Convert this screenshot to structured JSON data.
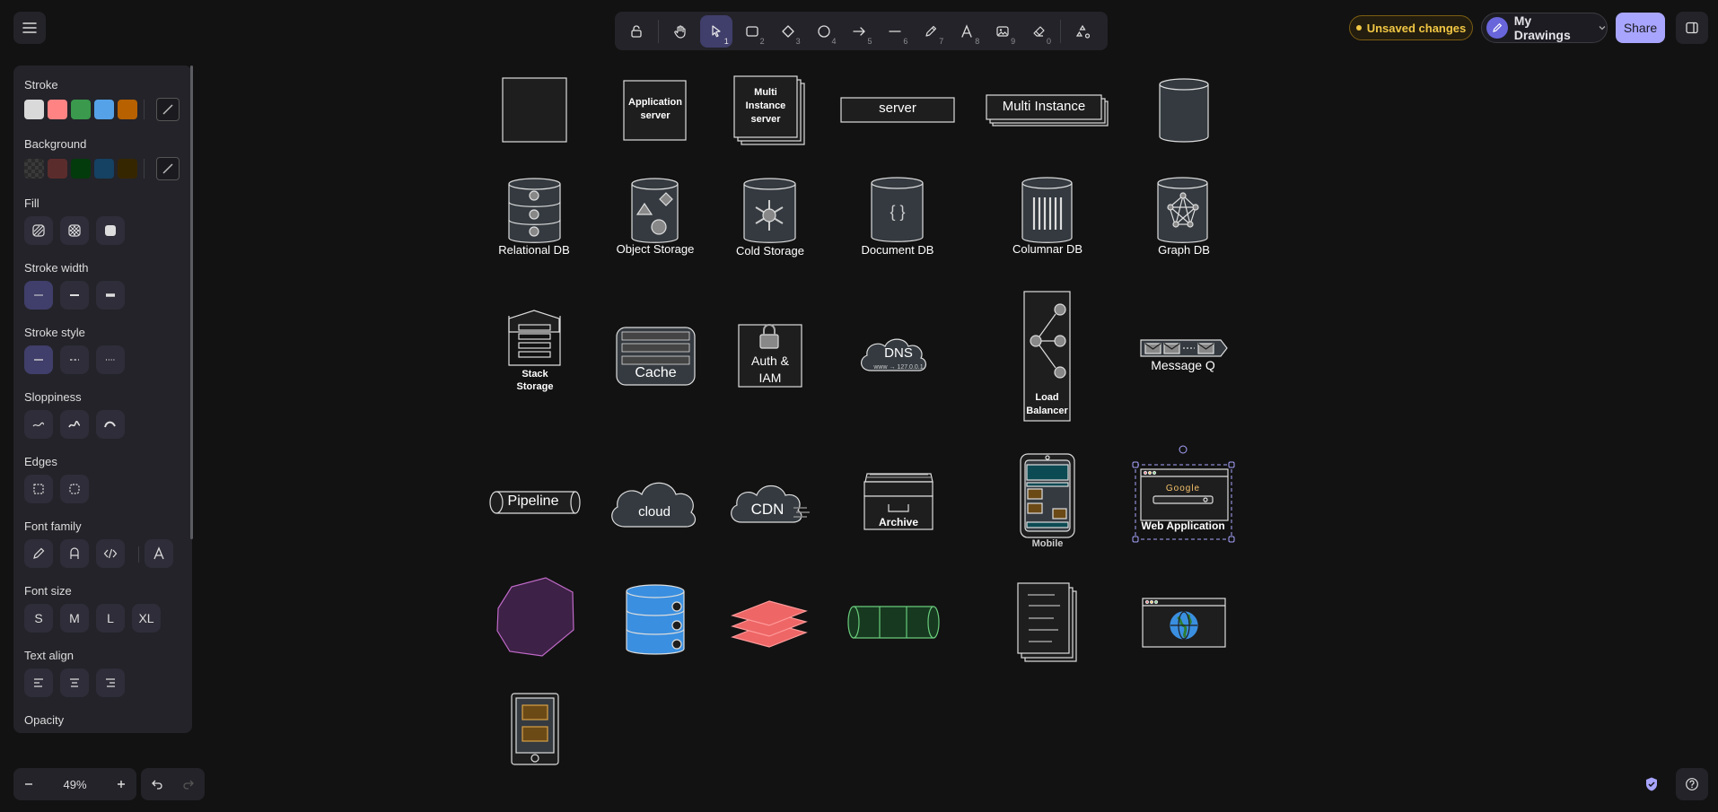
{
  "toolbar": {
    "tools": [
      {
        "name": "lock",
        "key": ""
      },
      {
        "name": "hand",
        "key": ""
      },
      {
        "name": "selection",
        "key": "1"
      },
      {
        "name": "rectangle",
        "key": "2"
      },
      {
        "name": "diamond",
        "key": "3"
      },
      {
        "name": "ellipse",
        "key": "4"
      },
      {
        "name": "arrow",
        "key": "5"
      },
      {
        "name": "line",
        "key": "6"
      },
      {
        "name": "draw",
        "key": "7"
      },
      {
        "name": "text",
        "key": "8"
      },
      {
        "name": "image",
        "key": "9"
      },
      {
        "name": "eraser",
        "key": "0"
      },
      {
        "name": "extra-tools",
        "key": ""
      }
    ]
  },
  "header": {
    "status": "Unsaved changes",
    "workspace": "My Drawings",
    "share_label": "Share"
  },
  "properties": {
    "stroke_label": "Stroke",
    "stroke_colors": [
      "#d9d9d9",
      "#ff8383",
      "#3a994c",
      "#56a2e8",
      "#b76100"
    ],
    "background_label": "Background",
    "background_colors": [
      "transparent",
      "#5b2c2c",
      "#043b0c",
      "#154163",
      "#362600"
    ],
    "fill_label": "Fill",
    "stroke_width_label": "Stroke width",
    "stroke_style_label": "Stroke style",
    "sloppiness_label": "Sloppiness",
    "edges_label": "Edges",
    "font_family_label": "Font family",
    "font_size_label": "Font size",
    "font_sizes": [
      "S",
      "M",
      "L",
      "XL"
    ],
    "text_align_label": "Text align",
    "opacity_label": "Opacity"
  },
  "footer": {
    "zoom": "49%"
  },
  "canvas": {
    "app_server": "Application server",
    "multi_server": "Multi Instance server",
    "server": "server",
    "multi_instance": "Multi Instance",
    "relational_db": "Relational DB",
    "object_storage": "Object Storage",
    "cold_storage": "Cold Storage",
    "document_db": "Document DB",
    "columnar_db": "Columnar DB",
    "graph_db": "Graph DB",
    "stack_storage": "Stack Storage",
    "cache": "Cache",
    "auth_iam": "Auth & IAM",
    "dns": "DNS",
    "dns_sub": "www → 127.0.0.1",
    "load_balancer": "Load Balancer",
    "message_q": "Message Q",
    "pipeline": "Pipeline",
    "cloud": "cloud",
    "cdn": "CDN",
    "archive": "Archive",
    "mobile": "Mobile",
    "google": "Google",
    "web_application": "Web Application",
    "doc_braces": "{ }"
  }
}
